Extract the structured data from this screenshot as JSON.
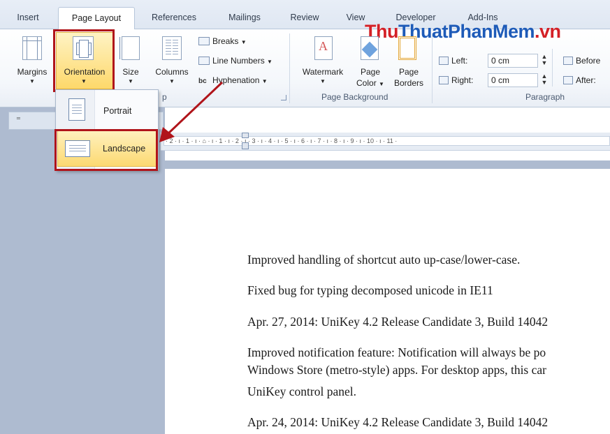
{
  "tabs": [
    "Insert",
    "Page Layout",
    "References",
    "Mailings",
    "Review",
    "View",
    "Developer",
    "Add-Ins"
  ],
  "active_tab": "Page Layout",
  "watermark_text": "ThuThuatPhanMem.vn",
  "page_setup": {
    "margins_label": "Margins",
    "orientation_label": "Orientation",
    "size_label": "Size",
    "columns_label": "Columns",
    "breaks_label": "Breaks",
    "line_numbers_label": "Line Numbers",
    "hyphenation_label": "Hyphenation",
    "group_label_partial": "p"
  },
  "page_background": {
    "watermark_label": "Watermark",
    "page_color_label_1": "Page",
    "page_color_label_2": "Color",
    "page_borders_label_1": "Page",
    "page_borders_label_2": "Borders",
    "group_label": "Page Background"
  },
  "paragraph": {
    "left_label": "Left:",
    "left_value": "0 cm",
    "right_label": "Right:",
    "right_value": "0 cm",
    "before_label": "Before",
    "after_label": "After:",
    "group_label": "Paragraph"
  },
  "orientation_menu": {
    "portrait_label": "Portrait",
    "landscape_label": "Landscape",
    "selected": "Landscape"
  },
  "ruler_text": "· 2 · ı · 1 · ı · ⌂ · ı · 1 · ı · 2 · ı · 3 · ı · 4 · ı · 5 · ı · 6 · ı · 7 · ı · 8 · ı · 9 · ı · 10 · ı · 11 ·",
  "document": {
    "lines": [
      "Improved handling of shortcut auto up-case/lower-case.",
      "Fixed bug for typing decomposed unicode in IE11",
      "Apr. 27, 2014: UniKey 4.2 Release Candidate 3, Build 14042",
      "Improved notification feature: Notification will always be po",
      "Windows Store (metro-style) apps. For desktop apps, this car",
      "UniKey control panel.",
      "Apr. 24, 2014: UniKey 4.2 Release Candidate 3, Build 14042"
    ]
  },
  "colors": {
    "highlight_border": "#b0141a",
    "selected_bg": "#fde58c",
    "watermark_blue": "#1e5bb8",
    "watermark_red": "#d42026"
  }
}
